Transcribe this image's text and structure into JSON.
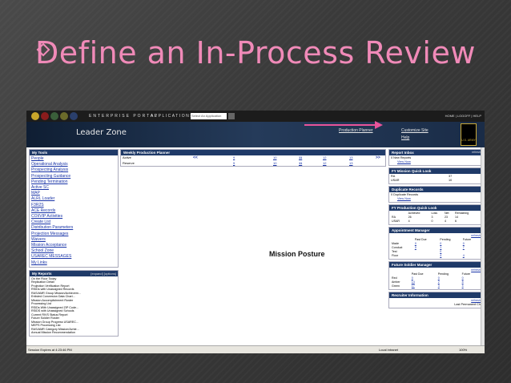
{
  "slide": {
    "title": "Define an In-Process Review"
  },
  "topnav": {
    "portal": "ENTERPRISE PORTAL",
    "applications": "APPLICATIONS",
    "app_select_placeholder": "Select An Application",
    "links": "HOME | LOGOFF | HELP"
  },
  "banner": {
    "title": "Leader Zone",
    "production_planner": "Production Planner",
    "customize_site": "Customize Site",
    "help": "Help",
    "logo_text": "U.S. ARMY"
  },
  "my_tools": {
    "title": "My Tools",
    "items": [
      "People",
      "Operational Analysis",
      "Prospecting Analysis",
      "Prospecting Guidance",
      "Pending Termination",
      "Active SC",
      "MAP",
      "ALRL Loader",
      "F3R2S",
      "ACE Records",
      "COI/VIP Activities",
      "Create List",
      "Distribution Parameters",
      "Projection Messages",
      "Waivers",
      "Mission Acceptance",
      "School Zone",
      "USAREC MESSAGES",
      "My Links"
    ]
  },
  "my_reports": {
    "title": "My Reports",
    "expand": "[expand]",
    "options": "[options]",
    "items": [
      "On the Floor Today",
      "Replication Detail",
      "Projection Verification Report",
      "RSIDs with Unassigned Records",
      "RAS/AMR Group Mission/Achievem...",
      "Enlisted Conversion Data Chart...",
      "Mission Accomplishment Roster",
      "Processing List",
      "RSIDs With Unassigned ZIP Code...",
      "RSIDS with Unassigned Schools",
      "Current RIVS Status Report",
      "Future Soldier Roster",
      "Mission Group Progress USAREC...",
      "MEPS Processing List",
      "RAS/AMR Category Mission/Achie...",
      "Annual Mission Recommendation"
    ]
  },
  "weekly_planner": {
    "title": "Weekly Production Planner",
    "prev": "<<",
    "next": ">>",
    "rows": [
      {
        "label": "Active",
        "values": [
          "9",
          "10",
          "11",
          "12",
          "13"
        ]
      },
      {
        "label": "Reserve",
        "values": [
          "9",
          "10",
          "11",
          "12",
          "13"
        ]
      }
    ]
  },
  "annotation": {
    "text": "Mission Posture"
  },
  "report_inbox": {
    "title": "Report Inbox",
    "refresh": "refresh",
    "line": "0 New Reports",
    "view": "View Now"
  },
  "fy_mission": {
    "title": "FY Mission Quick Look",
    "rows": [
      {
        "label": "RA",
        "value": "37"
      },
      {
        "label": "USAR",
        "value": "10"
      }
    ]
  },
  "duplicate_records": {
    "title": "Duplicate Records",
    "line": "0 Duplicate Records",
    "view": "View Now"
  },
  "fy_production": {
    "title": "FY Production Quick Look",
    "headers": [
      "",
      "Achieved",
      "Loss",
      "Net",
      "Remaining"
    ],
    "rows": [
      [
        "RA",
        "26",
        "3",
        "23",
        "14"
      ],
      [
        "USAR",
        "4",
        "0",
        "4",
        "6"
      ]
    ]
  },
  "appointment_manager": {
    "title": "Appointment Manager",
    "refresh": "refresh",
    "headers": [
      "",
      "Past Due",
      "Pending",
      "Future"
    ],
    "rows": [
      [
        "Made",
        "0",
        "0",
        "0"
      ],
      [
        "Conduct",
        "0",
        "1",
        "7"
      ],
      [
        "Test",
        "",
        "0",
        ""
      ],
      [
        "Floor",
        "",
        "4",
        "4"
      ]
    ]
  },
  "future_soldier": {
    "title": "Future Soldier Manager",
    "refresh": "refresh",
    "headers": [
      "",
      "Past Due",
      "Pending",
      "Future"
    ],
    "rows": [
      [
        "Red",
        "0",
        "0",
        "0"
      ],
      [
        "Amber",
        "14",
        "2",
        "8"
      ],
      [
        "Green",
        "17",
        "3",
        "4"
      ]
    ]
  },
  "recruiter_info": {
    "title": "Recruiter Information",
    "refresh": "refresh",
    "line": "Last Permanent Ch"
  },
  "statusbar": {
    "left": "Session Expires at 4:23:46 PM",
    "zone": "Local intranet",
    "zoom": "100%"
  },
  "colors": {
    "accent": "#f08ab8",
    "header": "#1f3a68",
    "link": "#1a35a8"
  }
}
